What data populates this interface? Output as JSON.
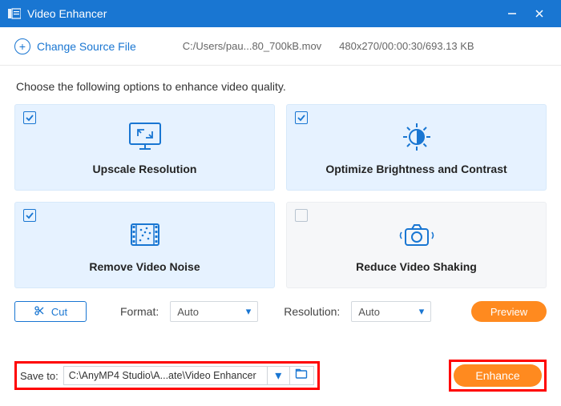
{
  "title": "Video Enhancer",
  "header": {
    "change_source": "Change Source File",
    "file_path": "C:/Users/pau...80_700kB.mov",
    "meta": "480x270/00:00:30/693.13 KB"
  },
  "prompt": "Choose the following options to enhance video quality.",
  "tiles": [
    {
      "label": "Upscale Resolution",
      "checked": true
    },
    {
      "label": "Optimize Brightness and Contrast",
      "checked": true
    },
    {
      "label": "Remove Video Noise",
      "checked": true
    },
    {
      "label": "Reduce Video Shaking",
      "checked": false
    }
  ],
  "cut": "Cut",
  "format_label": "Format:",
  "format_value": "Auto",
  "resolution_label": "Resolution:",
  "resolution_value": "Auto",
  "preview": "Preview",
  "save_to": "Save to:",
  "save_path": "C:\\AnyMP4 Studio\\A...ate\\Video Enhancer",
  "enhance": "Enhance"
}
